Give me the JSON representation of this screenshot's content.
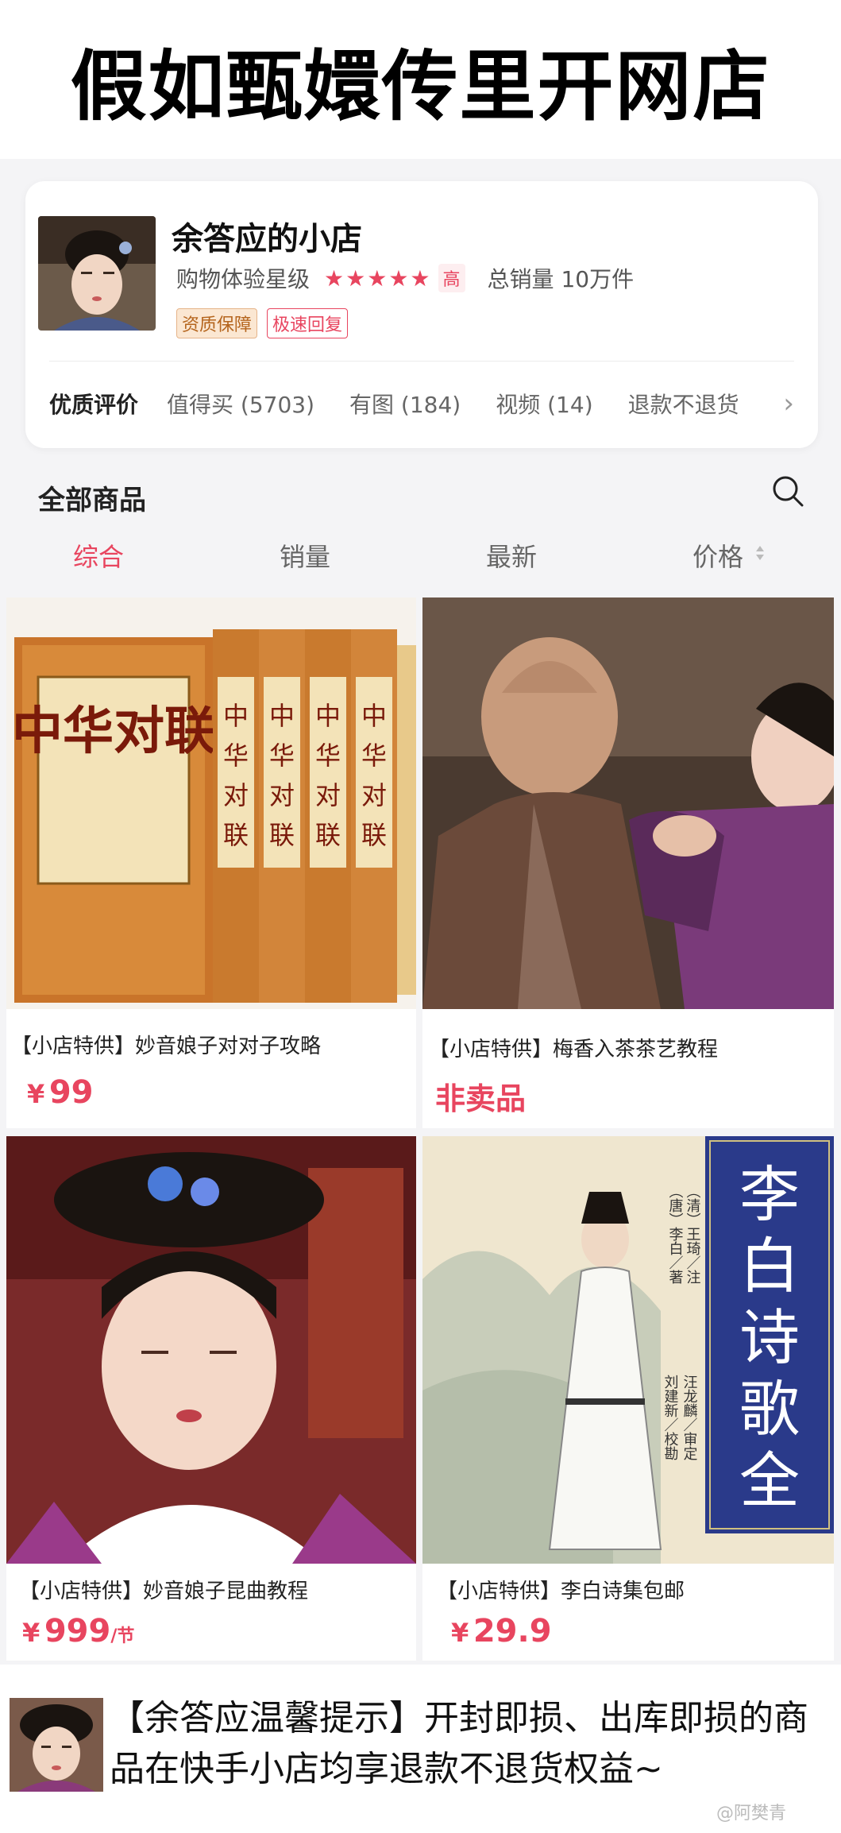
{
  "headline": "假如甄嬛传里开网店",
  "shop": {
    "name": "余答应的小店",
    "rating_label": "购物体验星级",
    "stars": "★★★★★",
    "rating_level": "高",
    "total_sales": "总销量 10万件",
    "badges": [
      "资质保障",
      "极速回复"
    ],
    "reviews": {
      "title": "优质评价",
      "filters": [
        "值得买 (5703)",
        "有图 (184)",
        "视频 (14)",
        "退款不退货"
      ]
    }
  },
  "section_title": "全部商品",
  "sort_tabs": [
    "综合",
    "销量",
    "最新",
    "价格"
  ],
  "products": [
    {
      "title": "【小店特供】妙音娘子对对子攻略",
      "price_symbol": "¥",
      "price": "99",
      "unit": ""
    },
    {
      "title": "【小店特供】梅香入茶茶艺教程",
      "price_symbol": "",
      "price": "非卖品",
      "unit": ""
    },
    {
      "title": "【小店特供】妙音娘子昆曲教程",
      "price_symbol": "¥",
      "price": "999",
      "unit": "/节"
    },
    {
      "title": "【小店特供】李白诗集包邮",
      "price_symbol": "¥",
      "price": "29.9",
      "unit": ""
    }
  ],
  "book1": {
    "title": "中华对联"
  },
  "book2": {
    "title": "李白诗歌全集",
    "authors": [
      "（唐）李白／著",
      "（清）王琦／注",
      "刘建新／校勘",
      "汪龙麟／审定"
    ]
  },
  "footer_tip": "【余答应温馨提示】开封即损、出库即损的商品在快手小店均享退款不退货权益~",
  "watermark": "@阿樊青",
  "colors": {
    "accent": "#e8455f",
    "background": "#f4f4f6"
  }
}
